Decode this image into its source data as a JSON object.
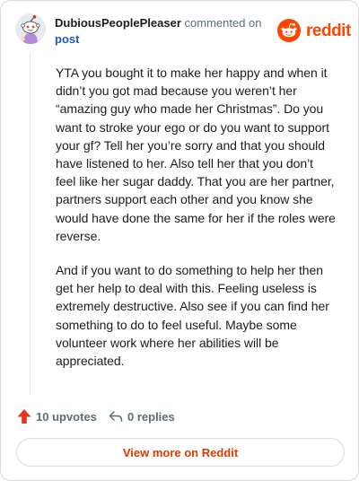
{
  "header": {
    "author": "DubiousPeoplePleaser",
    "action_text": "commented on",
    "post_link": "post",
    "brand": "reddit"
  },
  "comment": {
    "paragraphs": [
      "YTA you bought it to make her happy and when it didn’t you got mad because you weren’t her “amazing guy who made her Christmas”. Do you want to stroke your ego or do you want to support your gf? Tell her you’re sorry and that you should have listened to her. Also tell her that you don’t feel like her sugar daddy. That you are her partner, partners support each other and you know she would have done the same for her if the roles were reverse.",
      "And if you want to do something to help her then get her help to deal with this. Feeling useless is extremely destructive. Also see if you can find her something to do to feel useful. Maybe some volunteer work where her abilities will be appreciated."
    ]
  },
  "actions": {
    "upvotes": "10 upvotes",
    "replies": "0 replies"
  },
  "view_more": "View more on Reddit",
  "colors": {
    "brand": "#ff4500",
    "link": "#1c5ab5",
    "view_more_text": "#d93a00",
    "muted": "#576f76"
  },
  "icons": {
    "avatar": "snoo-avatar-icon",
    "brand": "reddit-logo-icon",
    "upvote": "upvote-arrow-icon",
    "reply": "reply-arrow-icon"
  }
}
